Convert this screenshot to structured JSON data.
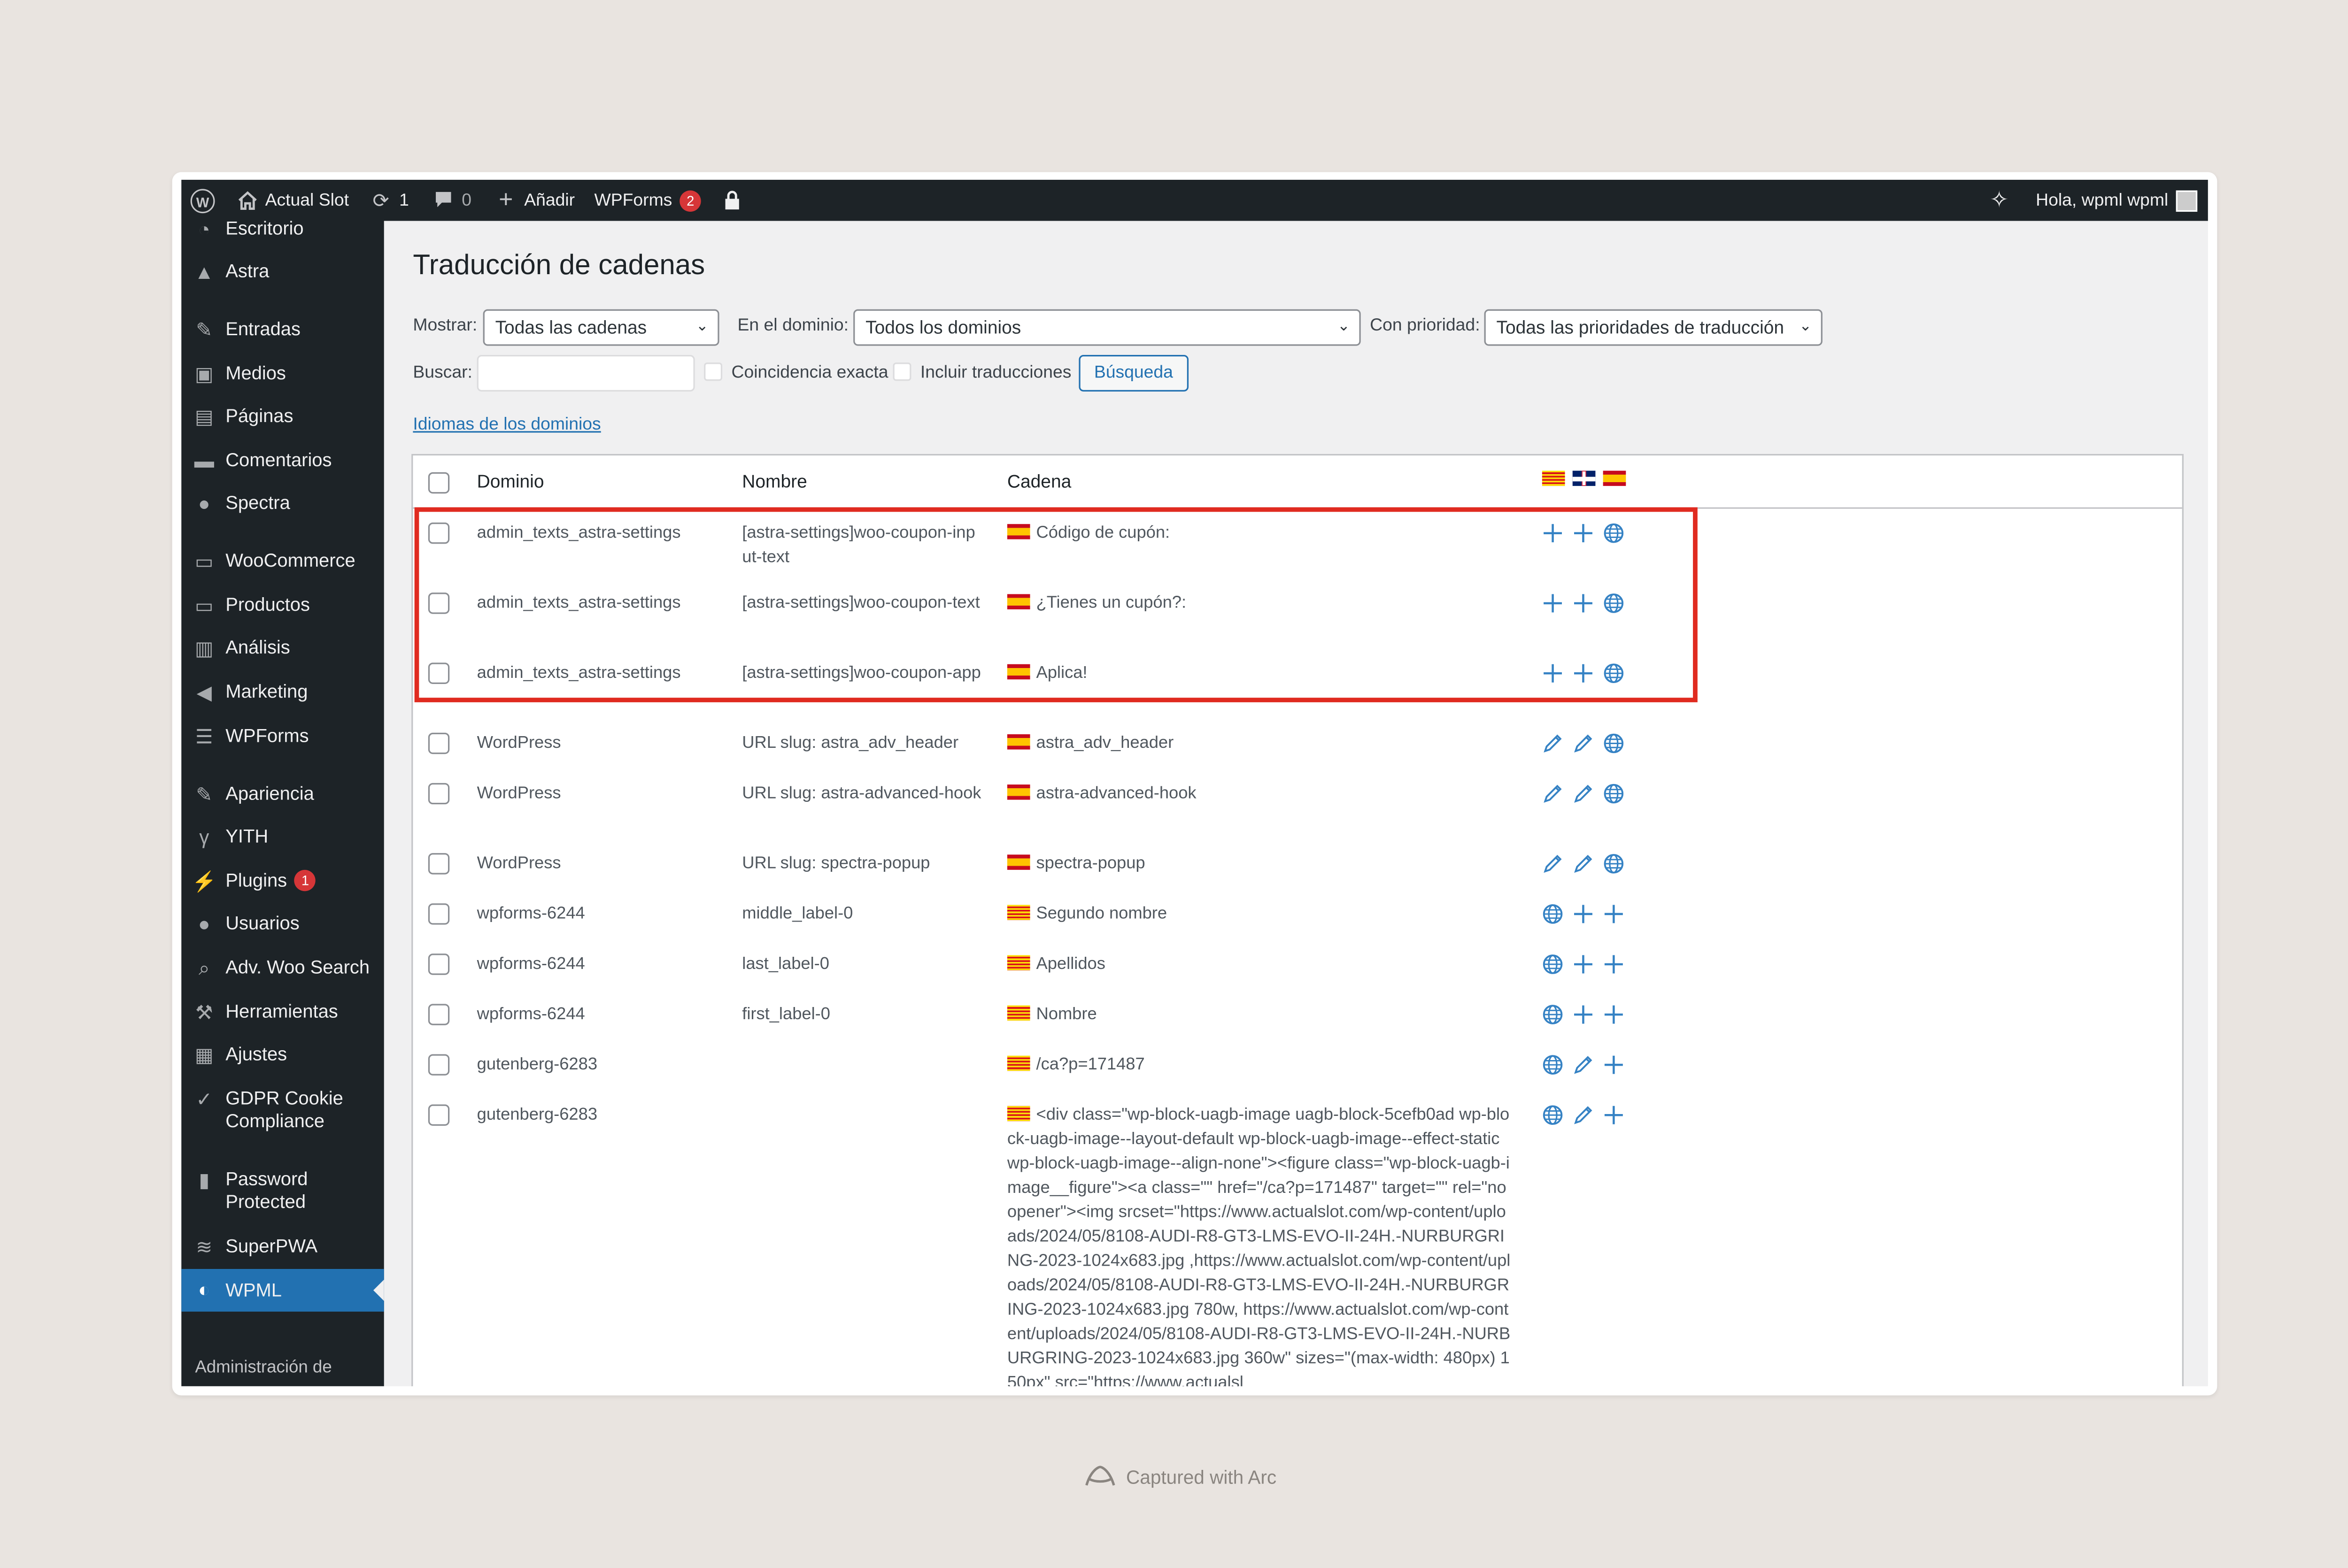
{
  "adminbar": {
    "site_name": "Actual Slot",
    "updates_count": "1",
    "comments_count": "0",
    "new_label": "Añadir",
    "wpforms_label": "WPForms",
    "wpforms_badge": "2",
    "greeting": "Hola, wpml wpml"
  },
  "sidebar": {
    "items": [
      {
        "label": "Escritorio",
        "icon": "dashboard-icon"
      },
      {
        "label": "Astra",
        "icon": "astra-icon"
      },
      {
        "label": "Entradas",
        "icon": "pin-icon"
      },
      {
        "label": "Medios",
        "icon": "media-icon"
      },
      {
        "label": "Páginas",
        "icon": "pages-icon"
      },
      {
        "label": "Comentarios",
        "icon": "comment-icon"
      },
      {
        "label": "Spectra",
        "icon": "spectra-icon"
      },
      {
        "label": "WooCommerce",
        "icon": "woo-icon"
      },
      {
        "label": "Productos",
        "icon": "products-icon"
      },
      {
        "label": "Análisis",
        "icon": "chart-icon"
      },
      {
        "label": "Marketing",
        "icon": "megaphone-icon"
      },
      {
        "label": "WPForms",
        "icon": "forms-icon"
      },
      {
        "label": "Apariencia",
        "icon": "brush-icon"
      },
      {
        "label": "YITH",
        "icon": "yith-icon"
      },
      {
        "label": "Plugins",
        "icon": "plugin-icon",
        "badge": "1"
      },
      {
        "label": "Usuarios",
        "icon": "user-icon"
      },
      {
        "label": "Adv. Woo Search",
        "icon": "search-icon"
      },
      {
        "label": "Herramientas",
        "icon": "wrench-icon"
      },
      {
        "label": "Ajustes",
        "icon": "settings-icon"
      },
      {
        "label": "GDPR Cookie Compliance",
        "icon": "check-icon"
      },
      {
        "label": "Password Protected",
        "icon": "lock-icon"
      },
      {
        "label": "SuperPWA",
        "icon": "pwa-icon"
      },
      {
        "label": "WPML",
        "icon": "wpml-icon"
      }
    ],
    "submenu_first": "Administración de"
  },
  "page": {
    "title": "Traducción de cadenas",
    "filters": {
      "show_label": "Mostrar:",
      "show_value": "Todas las cadenas",
      "domain_label": "En el dominio:",
      "domain_value": "Todos los dominios",
      "priority_label": "Con prioridad:",
      "priority_value": "Todas las prioridades de traducción",
      "search_label": "Buscar:",
      "exact_match": "Coincidencia exacta",
      "include_translations": "Incluir traducciones",
      "search_button": "Búsqueda"
    },
    "domain_languages_link": "Idiomas de los dominios"
  },
  "table": {
    "columns": [
      "Dominio",
      "Nombre",
      "Cadena"
    ],
    "header_flags": [
      "flag-ca",
      "flag-gb",
      "flag-es"
    ],
    "rows": [
      {
        "domain": "admin_texts_astra-settings",
        "name": "[astra-settings]woo-coupon-input-text",
        "flag": "flag-es",
        "string": "Código de cupón:",
        "actions": [
          "plus-icon",
          "plus-icon",
          "globe-icon"
        ]
      },
      {
        "domain": "admin_texts_astra-settings",
        "name": "[astra-settings]woo-coupon-text",
        "flag": "flag-es",
        "string": "¿Tienes un cupón?:",
        "actions": [
          "plus-icon",
          "plus-icon",
          "globe-icon"
        ]
      },
      {
        "domain": "admin_texts_astra-settings",
        "name": "[astra-settings]woo-coupon-apply-text",
        "flag": "flag-es",
        "string": "Aplica!",
        "actions": [
          "plus-icon",
          "plus-icon",
          "globe-icon"
        ]
      },
      {
        "domain": "WordPress",
        "name": "URL slug: astra_adv_header",
        "flag": "flag-es",
        "string": "astra_adv_header",
        "actions": [
          "pencil-icon",
          "pencil-icon",
          "globe-icon"
        ]
      },
      {
        "domain": "WordPress",
        "name": "URL slug: astra-advanced-hook",
        "flag": "flag-es",
        "string": "astra-advanced-hook",
        "actions": [
          "pencil-icon",
          "pencil-icon",
          "globe-icon"
        ]
      },
      {
        "domain": "WordPress",
        "name": "URL slug: spectra-popup",
        "flag": "flag-es",
        "string": "spectra-popup",
        "actions": [
          "pencil-icon",
          "pencil-icon",
          "globe-icon"
        ]
      },
      {
        "domain": "wpforms-6244",
        "name": "middle_label-0",
        "flag": "flag-ca",
        "string": "Segundo nombre",
        "actions": [
          "globe-icon",
          "plus-icon",
          "plus-icon"
        ]
      },
      {
        "domain": "wpforms-6244",
        "name": "last_label-0",
        "flag": "flag-ca",
        "string": "Apellidos",
        "actions": [
          "globe-icon",
          "plus-icon",
          "plus-icon"
        ]
      },
      {
        "domain": "wpforms-6244",
        "name": "first_label-0",
        "flag": "flag-ca",
        "string": "Nombre",
        "actions": [
          "globe-icon",
          "plus-icon",
          "plus-icon"
        ]
      },
      {
        "domain": "gutenberg-6283",
        "name": "",
        "flag": "flag-ca",
        "string": "/ca?p=171487",
        "actions": [
          "globe-icon",
          "pencil-icon",
          "plus-icon"
        ]
      },
      {
        "domain": "gutenberg-6283",
        "name": "",
        "flag": "flag-ca",
        "string": "<div class=\"wp-block-uagb-image uagb-block-5cefb0ad wp-block-uagb-image--layout-default wp-block-uagb-image--effect-static wp-block-uagb-image--align-none\"><figure class=\"wp-block-uagb-image__figure\"><a class=\"\" href=\"/ca?p=171487\" target=\"\" rel=\"noopener\"><img srcset=\"https://www.actualslot.com/wp-content/uploads/2024/05/8108-AUDI-R8-GT3-LMS-EVO-II-24H.-NURBURGRING-2023-1024x683.jpg ,https://www.actualslot.com/wp-content/uploads/2024/05/8108-AUDI-R8-GT3-LMS-EVO-II-24H.-NURBURGRING-2023-1024x683.jpg 780w, https://www.actualslot.com/wp-content/uploads/2024/05/8108-AUDI-R8-GT3-LMS-EVO-II-24H.-NURBURGRING-2023-1024x683.jpg 360w\" sizes=\"(max-width: 480px) 150px\" src=\"https://www.actualsl",
        "actions": [
          "globe-icon",
          "pencil-icon",
          "plus-icon"
        ]
      }
    ]
  },
  "footer": {
    "text": "Captured with Arc"
  },
  "colors": {
    "admin_dark": "#1d2327",
    "wp_blue": "#2271b1",
    "highlight": "#e02b20",
    "badge_red": "#d63638"
  }
}
